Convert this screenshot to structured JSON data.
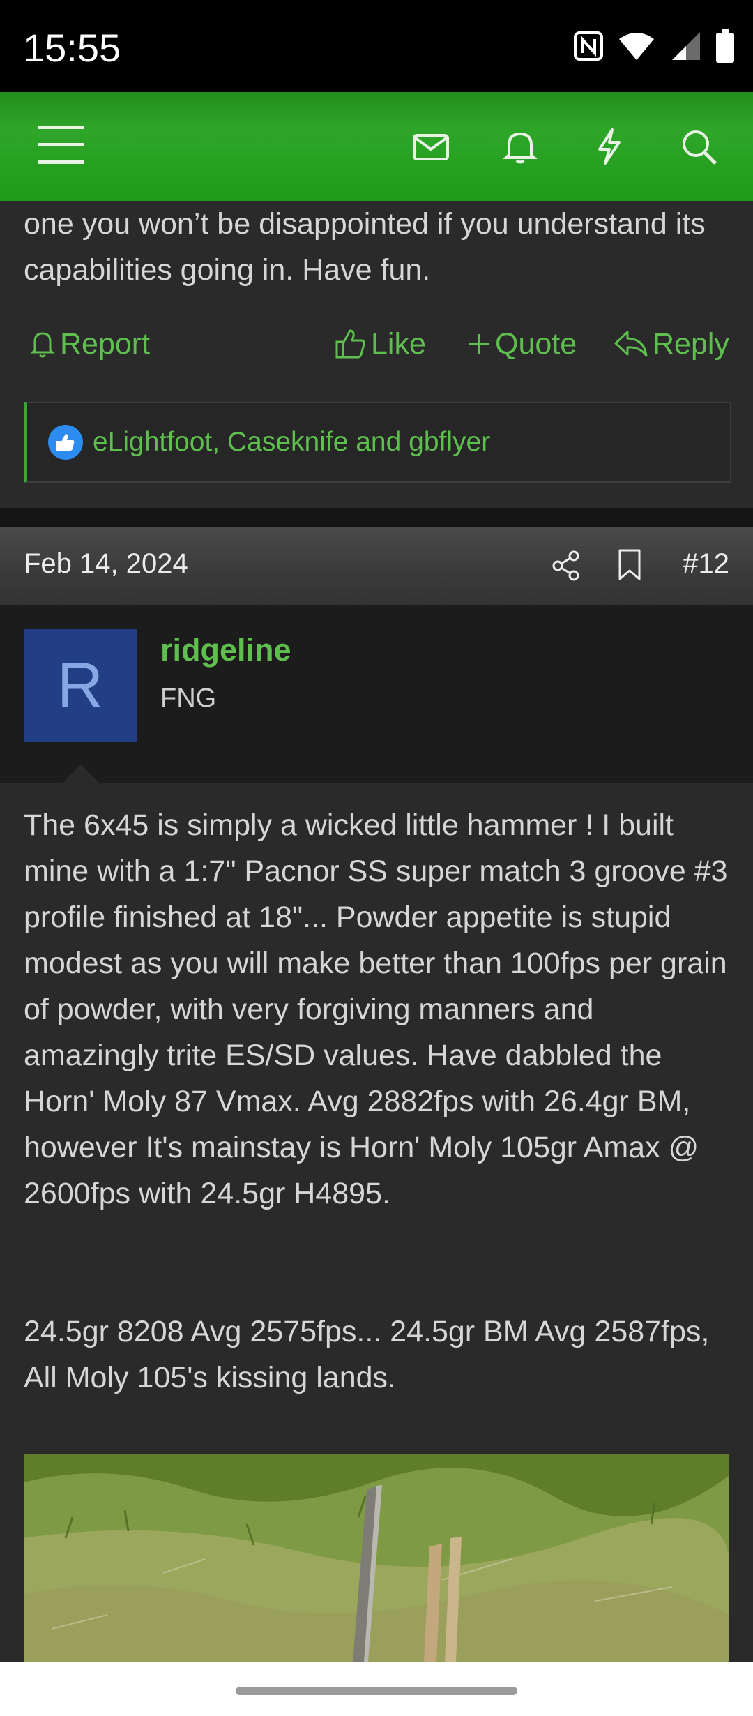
{
  "status_bar": {
    "time": "15:55",
    "icons": [
      "nfc-icon",
      "wifi-icon",
      "signal-icon",
      "battery-icon"
    ]
  },
  "app_header": {
    "icons": [
      "menu-icon",
      "inbox-icon",
      "bell-icon",
      "lightning-icon",
      "search-icon"
    ],
    "background_color": "#2a9e24"
  },
  "previous_post": {
    "text_tail": "one you won’t be disappointed if you understand its capabilities going in. Have fun.",
    "actions": {
      "report": "Report",
      "like": "Like",
      "quote": "Quote",
      "reply": "Reply"
    },
    "reactions_text": "eLightfoot, Caseknife and gbflyer"
  },
  "post": {
    "date": "Feb 14, 2024",
    "number": "#12",
    "user": {
      "avatar_letter": "R",
      "name": "ridgeline",
      "title": "FNG"
    },
    "paragraph_1": "The 6x45 is simply a wicked little hammer ! I built mine with a 1:7\" Pacnor SS super match 3 groove #3 profile finished at 18\"... Powder appetite is stupid modest as you will make better than 100fps per grain of powder, with very forgiving manners and amazingly trite ES/SD values. Have dabbled the Horn' Moly 87 Vmax. Avg 2882fps with 26.4gr BM, however It's mainstay is Horn' Moly 105gr Amax @ 2600fps with 24.5gr H4895.",
    "paragraph_2": "24.5gr 8208 Avg 2575fps... 24.5gr BM Avg 2587fps, All Moly 105's kissing lands."
  },
  "colors": {
    "accent_green": "#5fbf4e",
    "avatar_bg": "#223f86",
    "like_badge": "#2d8cf0"
  }
}
